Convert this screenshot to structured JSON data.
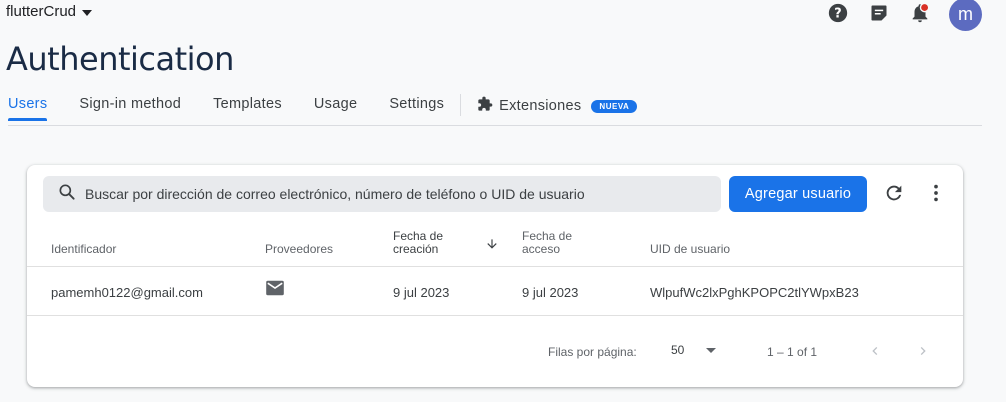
{
  "header": {
    "project": "flutterCrud",
    "avatar_letter": "m",
    "icons": [
      "help-icon",
      "feedback-icon",
      "notifications-icon"
    ]
  },
  "page_title": "Authentication",
  "tabs": [
    {
      "label": "Users",
      "active": true
    },
    {
      "label": "Sign-in method",
      "active": false
    },
    {
      "label": "Templates",
      "active": false
    },
    {
      "label": "Usage",
      "active": false
    },
    {
      "label": "Settings",
      "active": false
    }
  ],
  "extension_tab": {
    "label": "Extensiones",
    "badge": "NUEVA"
  },
  "search": {
    "placeholder": "Buscar por dirección de correo electrónico, número de teléfono o UID de usuario"
  },
  "add_button": "Agregar usuario",
  "table": {
    "columns": {
      "identifier": "Identificador",
      "providers": "Proveedores",
      "created_line1": "Fecha de",
      "created_line2": "creación",
      "signed_in_line1": "Fecha de",
      "signed_in_line2": "acceso",
      "uid": "UID de usuario"
    },
    "rows": [
      {
        "identifier": "pamemh0122@gmail.com",
        "provider_icon": "email-icon",
        "created": "9 jul 2023",
        "signed_in": "9 jul 2023",
        "uid": "WlpufWc2lxPghKPOPC2tlYWpxB23"
      }
    ]
  },
  "pagination": {
    "rows_per_page_label": "Filas por página:",
    "rows_per_page": "50",
    "range": "1 – 1 of 1"
  },
  "colors": {
    "accent": "#1a73e8",
    "title": "#1a2b45",
    "avatar": "#5c6bc0"
  }
}
